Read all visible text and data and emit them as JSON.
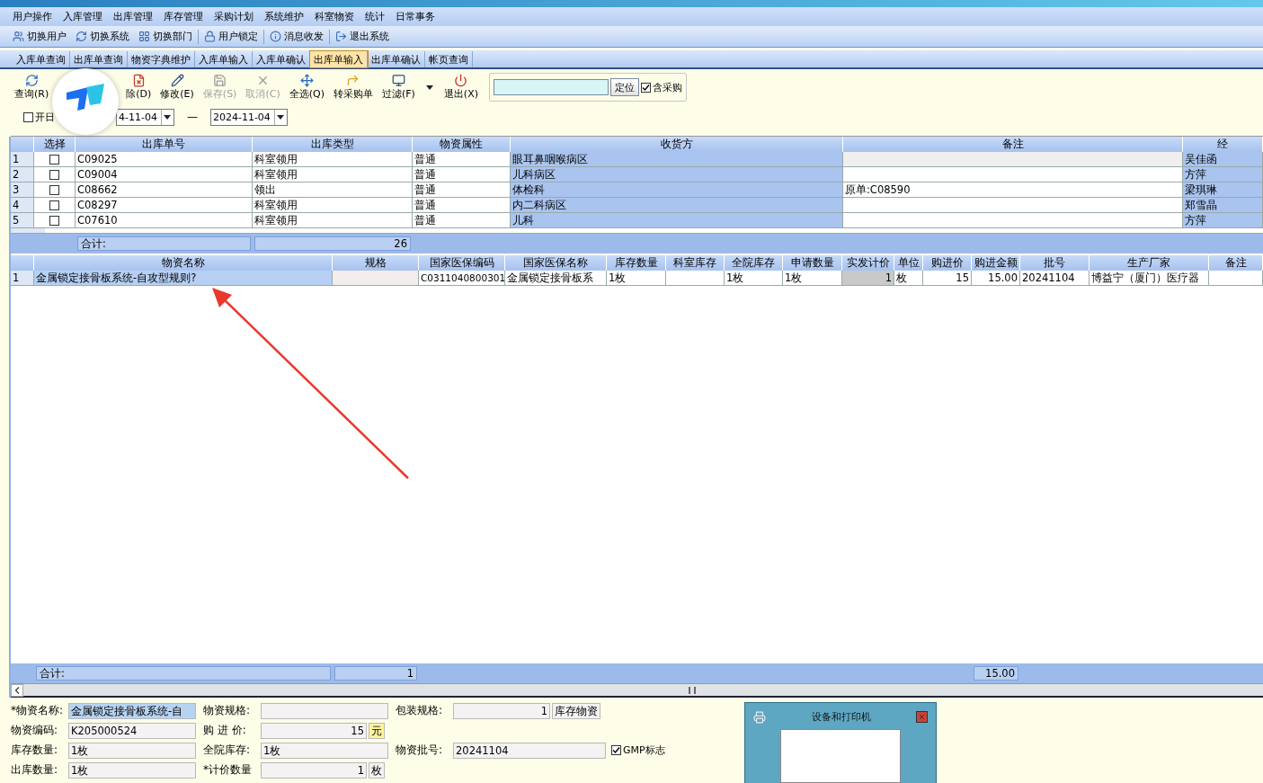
{
  "menu": [
    "用户操作",
    "入库管理",
    "出库管理",
    "库存管理",
    "采购计划",
    "系统维护",
    "科室物资",
    "统计",
    "日常事务"
  ],
  "toolbar": [
    {
      "label": "切换用户"
    },
    {
      "label": "切换系统"
    },
    {
      "label": "切换部门"
    },
    {
      "label": "用户锁定"
    },
    {
      "label": "消息收发"
    },
    {
      "label": "退出系统"
    }
  ],
  "tabs": [
    {
      "label": "入库单查询",
      "selected": false
    },
    {
      "label": "出库单查询",
      "selected": false
    },
    {
      "label": "物资字典维护",
      "selected": false
    },
    {
      "label": "入库单输入",
      "selected": false
    },
    {
      "label": "入库单确认",
      "selected": false
    },
    {
      "label": "出库单输入",
      "selected": true
    },
    {
      "label": "出库单确认",
      "selected": false
    },
    {
      "label": "帐页查询",
      "selected": false
    }
  ],
  "actions": [
    {
      "label": "查询(R)",
      "disabled": false
    },
    {
      "label": "除(D)",
      "disabled": false
    },
    {
      "label": "修改(E)",
      "disabled": false
    },
    {
      "label": "保存(S)",
      "disabled": true
    },
    {
      "label": "取消(C)",
      "disabled": true
    },
    {
      "label": "全选(Q)",
      "disabled": false
    },
    {
      "label": "转采购单",
      "disabled": false
    },
    {
      "label": "过滤(F)",
      "disabled": false
    },
    {
      "label": "退出(X)",
      "disabled": false
    }
  ],
  "locate": {
    "button": "定位",
    "checkbox": {
      "label": "含采购",
      "checked": true
    }
  },
  "date_filter": {
    "checkbox": {
      "label": "开日",
      "checked": false
    },
    "from": "4-11-04",
    "separator": "—",
    "to": "2024-11-04"
  },
  "orders": {
    "columns": [
      "选择",
      "出库单号",
      "出库类型",
      "物资属性",
      "收货方",
      "备注",
      "经"
    ],
    "rows": [
      {
        "index": "1",
        "checked": false,
        "number": "C09025",
        "type": "科室领用",
        "attribute": "普通",
        "receiver": "眼耳鼻咽喉病区",
        "handler": "吴佳函"
      },
      {
        "index": "2",
        "checked": false,
        "number": "C09004",
        "type": "科室领用",
        "attribute": "普通",
        "receiver": "儿科病区",
        "handler": "方萍"
      },
      {
        "index": "3",
        "checked": false,
        "number": "C08662",
        "type": "领出",
        "attribute": "普通",
        "receiver": "体检科",
        "remark": "原单:C08590",
        "handler": "梁琪琳"
      },
      {
        "index": "4",
        "checked": false,
        "number": "C08297",
        "type": "科室领用",
        "attribute": "普通",
        "receiver": "内二科病区",
        "handler": "郑雪晶"
      },
      {
        "index": "5",
        "checked": false,
        "number": "C07610",
        "type": "科室领用",
        "attribute": "普通",
        "receiver": "儿科",
        "handler": "方萍"
      }
    ],
    "total_label": "合计:",
    "total": "26"
  },
  "items": {
    "columns": [
      "物资名称",
      "规格",
      "国家医保编码",
      "国家医保名称",
      "库存数量",
      "科室库存",
      "全院库存",
      "申请数量",
      "实发计价",
      "单位",
      "购进价",
      "购进金额",
      "批号",
      "生产厂家",
      "备注"
    ],
    "rows": [
      {
        "index": "1",
        "name": "金属锁定接骨板系统-自攻型规则?",
        "code": "C0311040800301",
        "insurance_name": "金属锁定接骨板系",
        "stock": "1枚",
        "hospital_stock": "1枚",
        "requested": "1枚",
        "issued": "1",
        "unit": "枚",
        "price": "15",
        "amount": "15.00",
        "batch": "20241104",
        "maker": "博益宁（厦门）医疗器"
      }
    ],
    "total_label": "合计:",
    "total_quantity": "1",
    "total_amount": "15.00"
  },
  "form": {
    "columns": [
      [
        {
          "kind": "field",
          "label": "*物资名称:",
          "value": "金属锁定接骨板系统-自",
          "highlighted": true
        },
        {
          "kind": "field",
          "label": "物资编码:",
          "value": "K205000524"
        },
        {
          "kind": "field",
          "label": "库存数量:",
          "value": "1枚"
        },
        {
          "kind": "field",
          "label": "出库数量:",
          "value": "1枚"
        }
      ],
      [
        {
          "kind": "field",
          "label": "物资规格:"
        },
        {
          "kind": "field",
          "label": "购 进 价:",
          "value": "15",
          "right_aligned": true,
          "unit": "元",
          "unit_highlighted": true
        },
        {
          "kind": "field",
          "label": "全院库存:",
          "value": "1枚"
        },
        {
          "kind": "field",
          "label": "*计价数量",
          "value": "1",
          "right_aligned": true,
          "unit": "枚"
        }
      ],
      [
        {
          "kind": "field",
          "label": "包装规格:",
          "value": "1",
          "right_aligned": true,
          "button": "库存物资"
        },
        {
          "kind": "blank"
        },
        {
          "kind": "field",
          "label": "物资批号:",
          "value": "20241104",
          "checkbox": {
            "label": "GMP标志",
            "checked": true
          }
        }
      ]
    ]
  },
  "preview": {
    "title": "设备和打印机"
  }
}
